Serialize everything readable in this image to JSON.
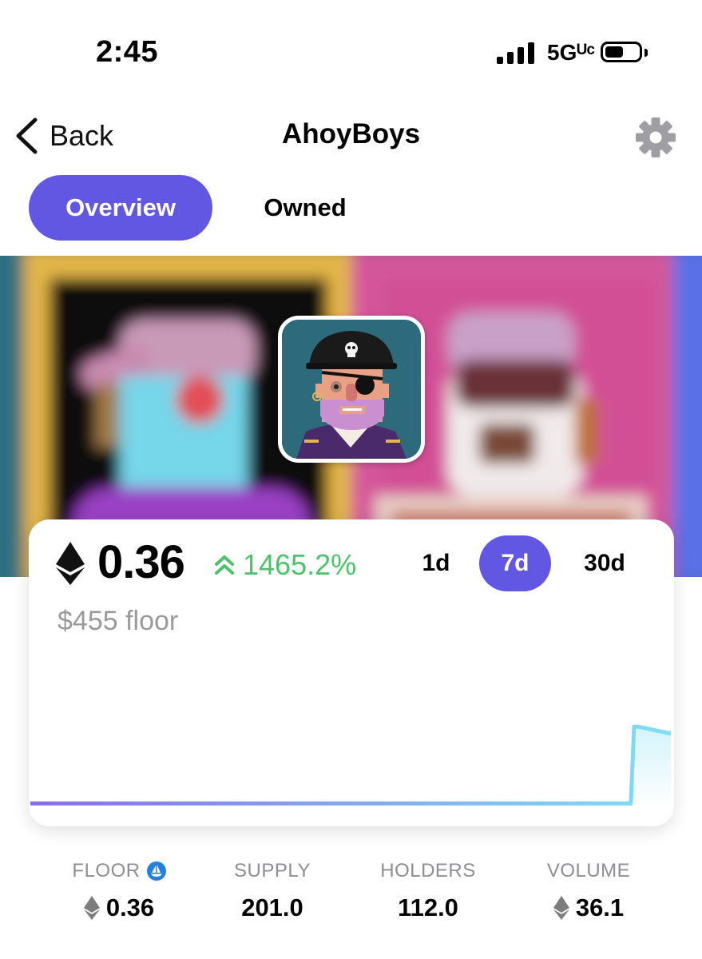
{
  "status_bar": {
    "time": "2:45",
    "network": "5Gᵁᶜ",
    "icons": [
      "cellular-signal-icon",
      "battery-icon"
    ]
  },
  "nav": {
    "back_label": "Back",
    "title": "AhoyBoys",
    "settings_icon": "gear-icon"
  },
  "tabs": [
    {
      "label": "Overview",
      "active": true
    },
    {
      "label": "Owned",
      "active": false
    }
  ],
  "colors": {
    "accent": "#6257e3",
    "positive": "#4cc36a",
    "muted": "#8e8e93"
  },
  "card": {
    "price": "0.36",
    "change": "1465.2%",
    "change_icon": "double-chevron-up-icon",
    "usd_floor": "$455 floor",
    "ranges": [
      {
        "label": "1d",
        "active": false
      },
      {
        "label": "7d",
        "active": true
      },
      {
        "label": "30d",
        "active": false
      }
    ]
  },
  "chart_data": {
    "type": "line",
    "title": "",
    "xlabel": "",
    "ylabel": "",
    "x": [
      0,
      1,
      2,
      3,
      4,
      5,
      6,
      7,
      8,
      9,
      10,
      11,
      12,
      13,
      14,
      15,
      16,
      17,
      18,
      19,
      20
    ],
    "values": [
      0.023,
      0.023,
      0.023,
      0.023,
      0.023,
      0.023,
      0.023,
      0.023,
      0.023,
      0.023,
      0.023,
      0.023,
      0.023,
      0.023,
      0.023,
      0.023,
      0.023,
      0.023,
      0.023,
      0.36,
      0.33
    ],
    "ylim": [
      0,
      0.4
    ],
    "grid": false,
    "legend": "none"
  },
  "stats": [
    {
      "label": "FLOOR",
      "value": "0.36",
      "eth_icon": true,
      "badge_icon": "opensea-icon"
    },
    {
      "label": "SUPPLY",
      "value": "201.0",
      "eth_icon": false
    },
    {
      "label": "HOLDERS",
      "value": "112.0",
      "eth_icon": false
    },
    {
      "label": "VOLUME",
      "value": "36.1",
      "eth_icon": true
    }
  ]
}
